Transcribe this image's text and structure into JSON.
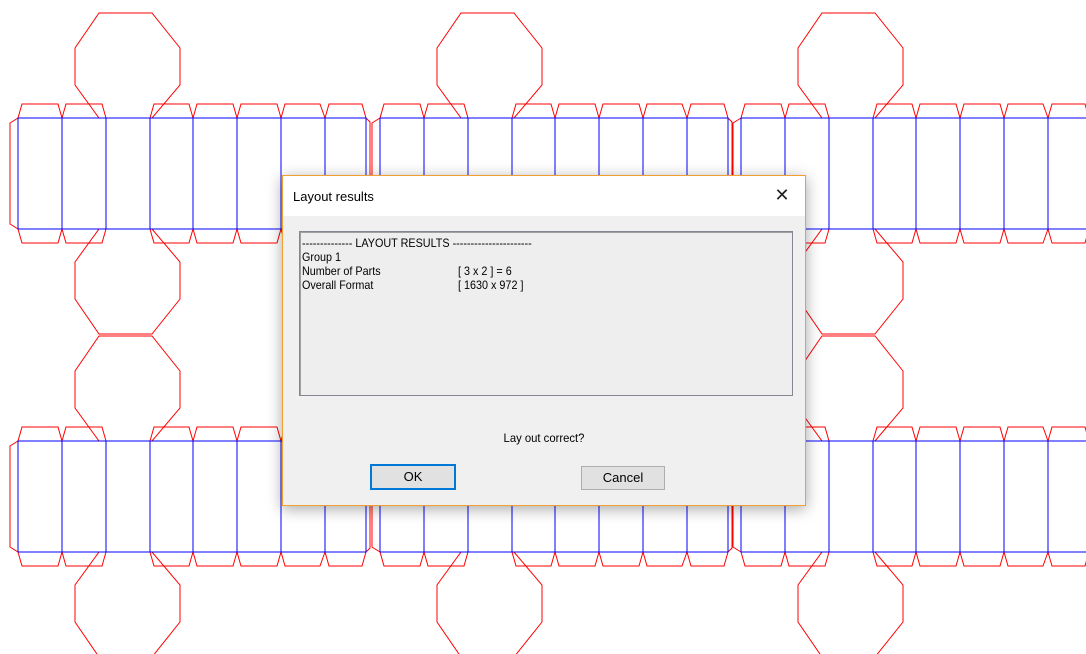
{
  "dialog": {
    "title": "Layout results",
    "close_glyph": "✕",
    "results": {
      "header": "-------------- LAYOUT RESULTS ----------------------",
      "group": "Group 1",
      "rows": [
        {
          "label": "Number of Parts",
          "value": "[ 3 x 2 ] = 6"
        },
        {
          "label": "Overall Format",
          "value": "[ 1630 x 972 ]"
        }
      ]
    },
    "question": "Lay out correct?",
    "ok_label": "OK",
    "cancel_label": "Cancel"
  },
  "drawing": {
    "cut_line_color": "#ff0000",
    "crease_line_color": "#0000ff"
  }
}
